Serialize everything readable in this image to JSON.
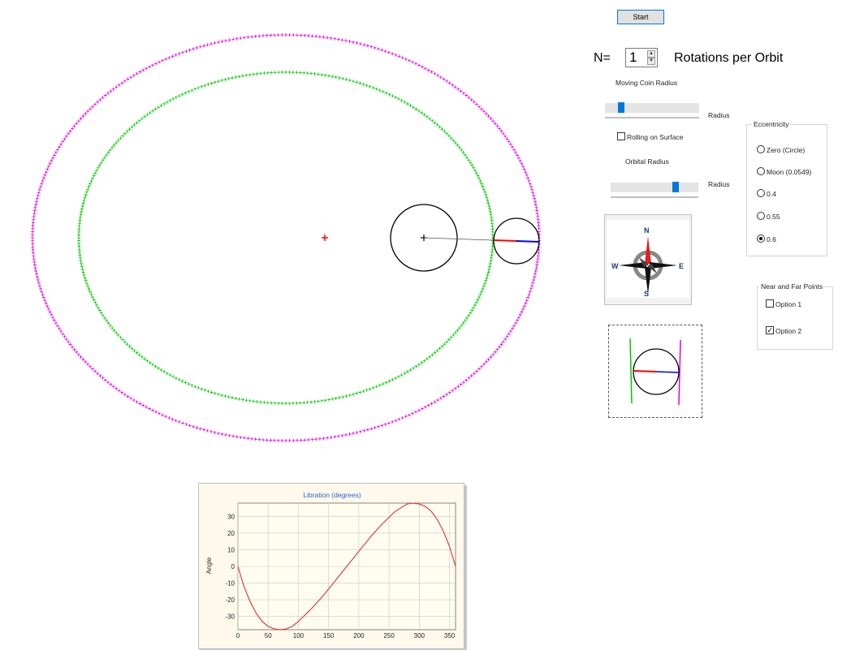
{
  "controls": {
    "start_label": "Start",
    "n_label": "N=",
    "n_value": "1",
    "rotations_label": "Rotations per Orbit",
    "moving_coin_label": "Moving Coin Radius",
    "radius_label_1": "Radius",
    "rolling_label": "Rolling on Surface",
    "rolling_checked": false,
    "orbital_label": "Orbital Radius",
    "radius_label_2": "Radius",
    "moving_coin_slider": 0.17,
    "orbital_slider": 0.74
  },
  "eccentricity": {
    "title": "Eccentricity",
    "options": [
      "Zero (Circle)",
      "Moon (0.0549)",
      "0.4",
      "0.55",
      "0.6"
    ],
    "selected_index": 4
  },
  "near_far": {
    "title": "Near and Far Points",
    "options": [
      {
        "label": "Option 1",
        "checked": false
      },
      {
        "label": "Option 2",
        "checked": true
      }
    ]
  },
  "compass": {
    "n": "N",
    "s": "S",
    "e": "E",
    "w": "W"
  },
  "colors": {
    "outer_orbit": "#e000e0",
    "inner_orbit": "#00c800",
    "focus": "#ff0000",
    "accent": "#0078d7",
    "curve": "#e04040"
  },
  "chart_data": {
    "type": "line",
    "title": "Libration (degrees)",
    "ylabel": "Angle",
    "xlabel": "",
    "xlim": [
      0,
      360
    ],
    "ylim": [
      -38,
      38
    ],
    "xticks": [
      0,
      50,
      100,
      150,
      200,
      250,
      300,
      350
    ],
    "yticks": [
      30,
      20,
      10,
      0,
      -10,
      -20,
      -30
    ],
    "grid": true,
    "series": [
      {
        "x": [
          0,
          10,
          20,
          30,
          40,
          50,
          60,
          70,
          80,
          90,
          100,
          120,
          140,
          160,
          180,
          200,
          220,
          240,
          260,
          280,
          290,
          300,
          310,
          320,
          330,
          340,
          350,
          360
        ],
        "values": [
          0,
          -12,
          -21,
          -28,
          -33,
          -36,
          -37.5,
          -38,
          -37.5,
          -36,
          -33,
          -26,
          -18,
          -9,
          0,
          9,
          18,
          26,
          33,
          37.5,
          38,
          37.5,
          36,
          33,
          28,
          21,
          12,
          0
        ]
      }
    ]
  }
}
